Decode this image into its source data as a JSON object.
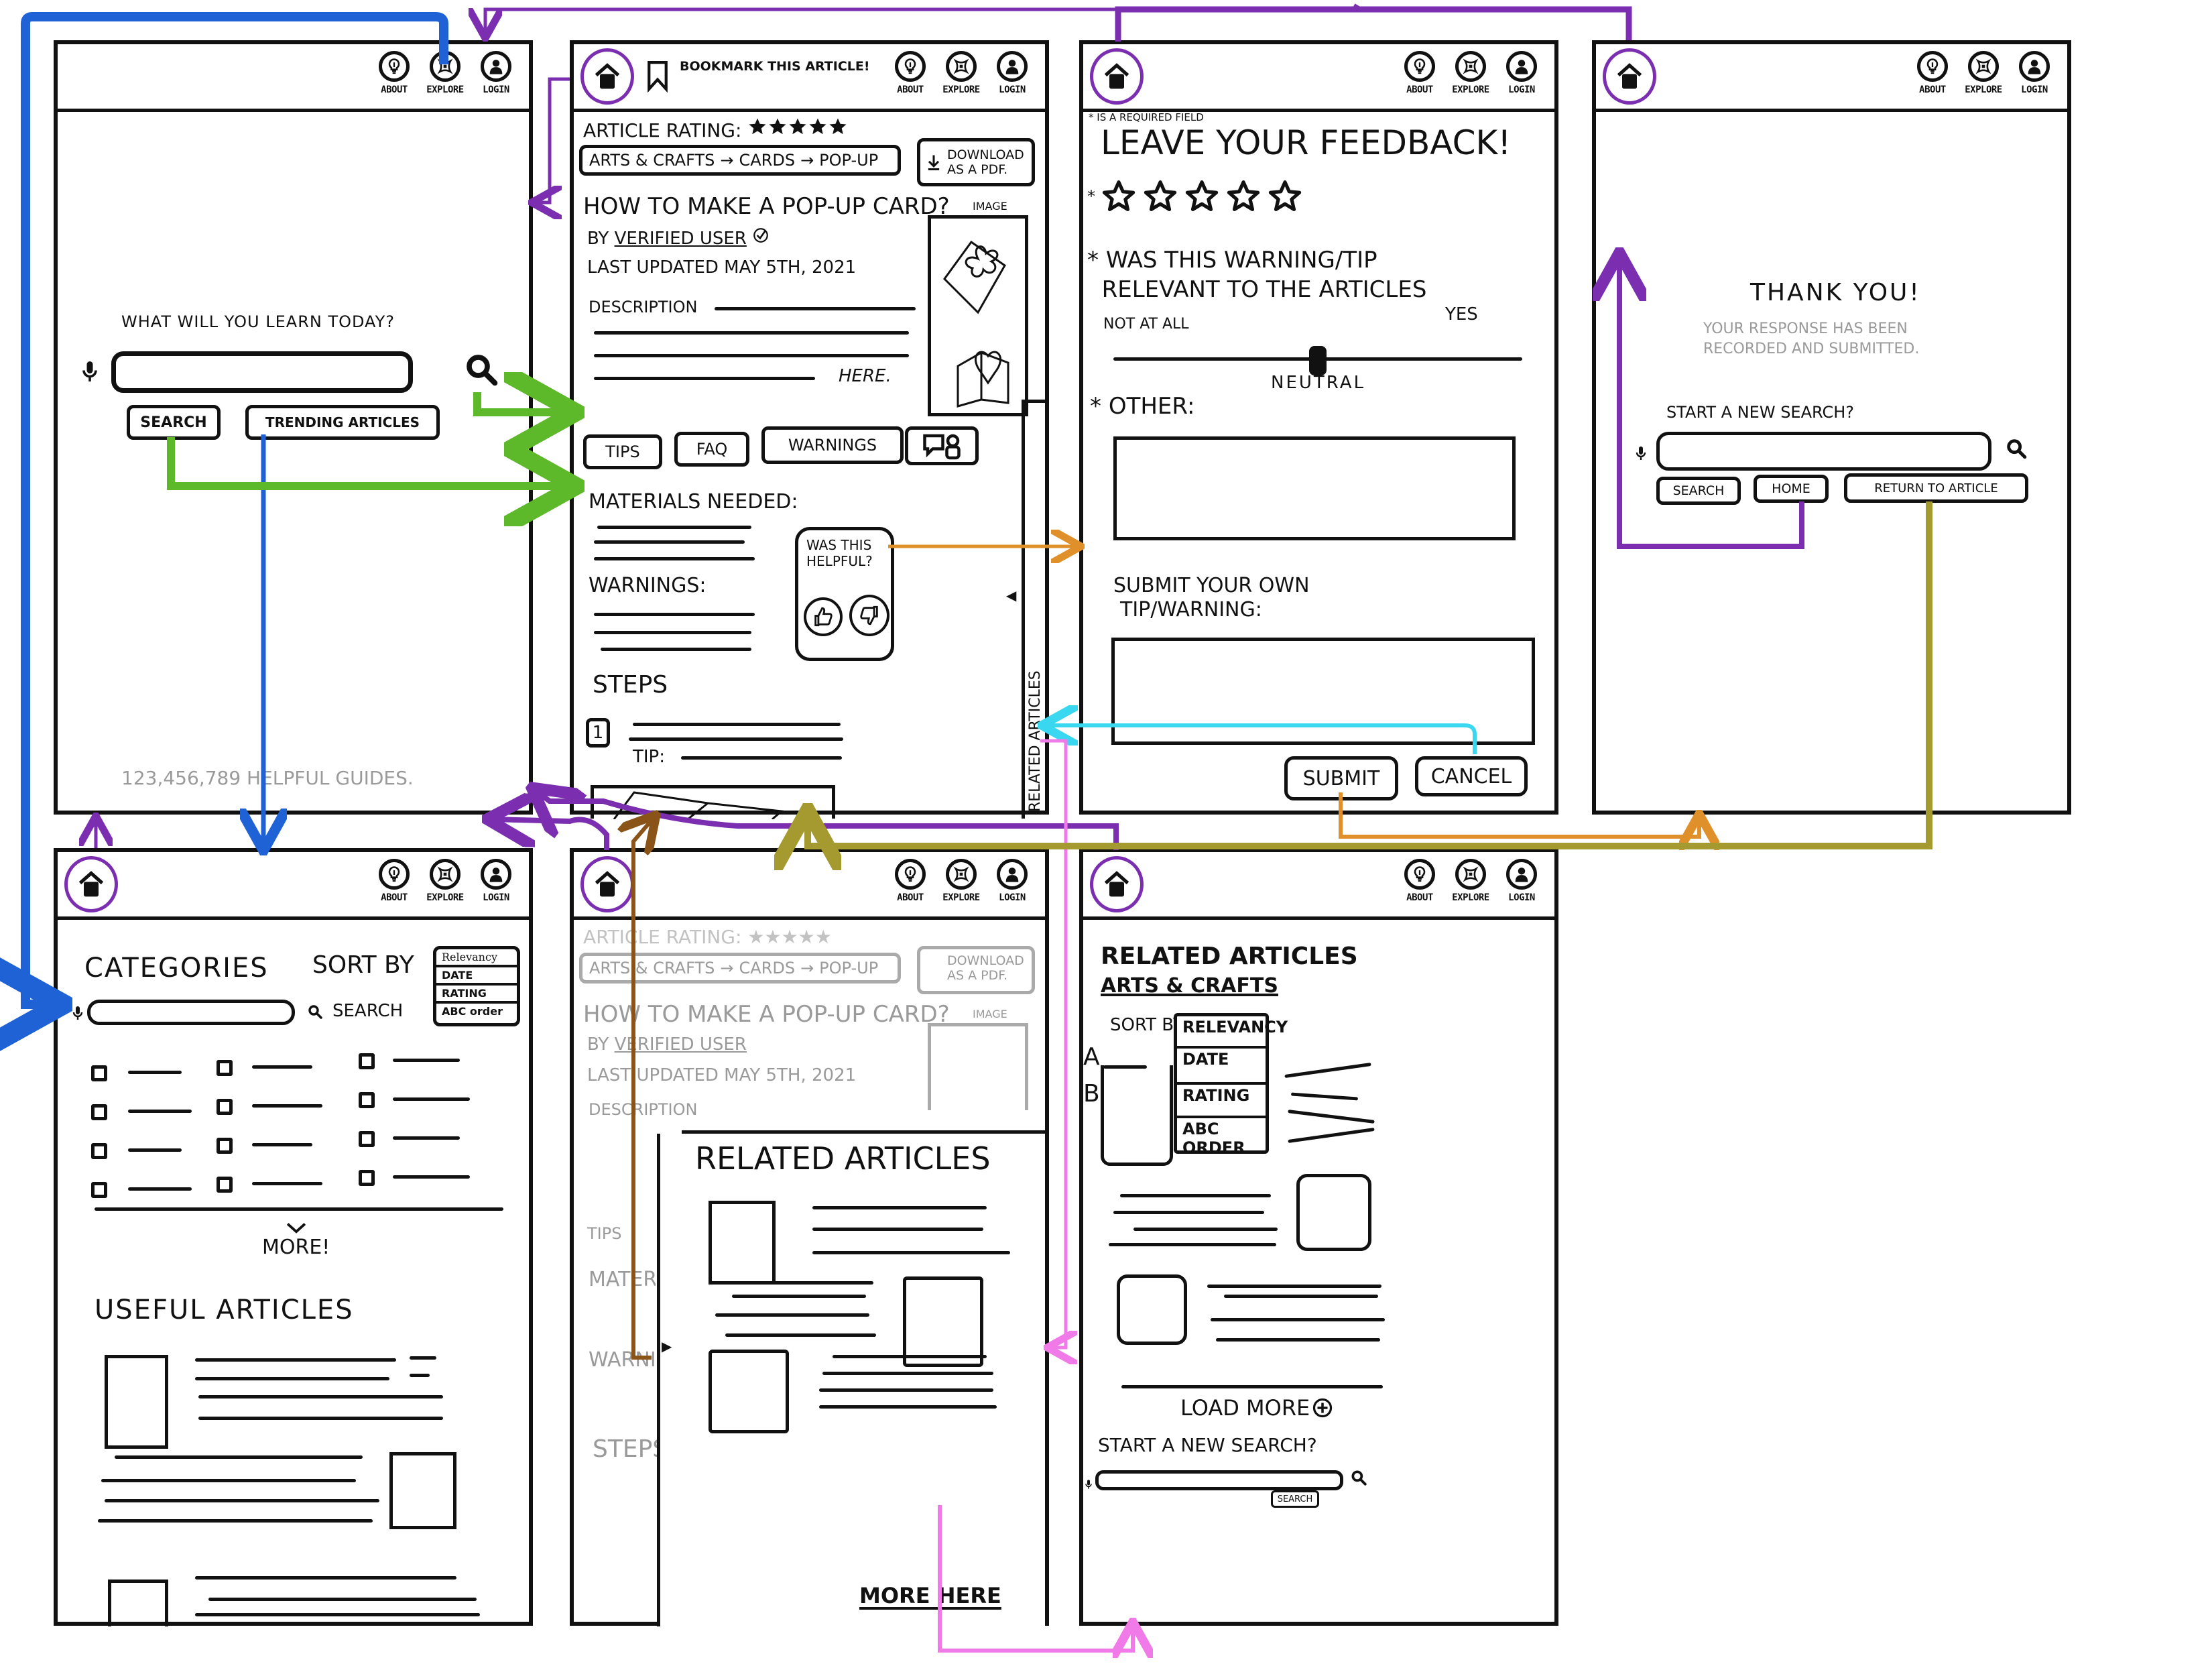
{
  "nav": {
    "about": "ABOUT",
    "explore": "EXPLORE",
    "login": "LOGIN",
    "icons": {
      "about": "lightbulb-icon",
      "explore": "compass-icon",
      "login": "user-icon",
      "home": "home-icon"
    }
  },
  "colors": {
    "ink": "#111111",
    "faded": "#9a9a9a",
    "flow_blue": "#1e62d6",
    "flow_purple": "#7b2fb0",
    "flow_green": "#5db82a",
    "flow_orange": "#e0902a",
    "flow_cyan": "#3ad8f0",
    "flow_pink": "#f07ae8",
    "flow_olive": "#a59a30",
    "flow_brown": "#8a5418"
  },
  "home_screen": {
    "prompt": "WHAT WILL YOU LEARN TODAY?",
    "search_placeholder": "",
    "search_button": "SEARCH",
    "trending_button": "TRENDING ARTICLES",
    "footer_count": "123,456,789",
    "footer_text": "HELPFUL GUIDES."
  },
  "article_screen": {
    "bookmark": "BOOKMARK THIS ARTICLE!",
    "rating_label": "ARTICLE RATING:",
    "rating_stars": 5,
    "breadcrumb": [
      "ARTS & CRAFTS",
      "CARDS",
      "POP-UP"
    ],
    "breadcrumb_sep": "→",
    "download_line1": "DOWNLOAD",
    "download_line2": "AS A PDF.",
    "title": "HOW TO MAKE A POP-UP CARD?",
    "by_label": "BY",
    "author": "VERIFIED USER",
    "updated": "LAST UPDATED MAY 5TH, 2021",
    "description_label": "DESCRIPTION",
    "description_end": "HERE.",
    "image_label": "IMAGE",
    "tabs": [
      "TIPS",
      "FAQ",
      "WARNINGS"
    ],
    "materials_label": "MATERIALS NEEDED:",
    "warnings_label": "WARNINGS:",
    "helpful_line1": "WAS THIS",
    "helpful_line2": "HELPFUL?",
    "steps_label": "STEPS",
    "step_number": "1",
    "tip_label": "TIP:",
    "related_tab": "RELATED ARTICLES"
  },
  "feedback_screen": {
    "required_note": "IS A REQUIRED FIELD",
    "title": "LEAVE YOUR FEEDBACK!",
    "star_count": 5,
    "question_line1": "WAS THIS WARNING/TIP",
    "question_line2": "RELEVANT TO THE ARTICLES",
    "slider_min": "NOT AT ALL",
    "slider_max": "YES",
    "slider_mid": "NEUTRAL",
    "slider_value": 0.5,
    "other_label": "OTHER:",
    "submit_own_line1": "SUBMIT YOUR OWN",
    "submit_own_line2": "TIP/WARNING:",
    "submit_button": "SUBMIT",
    "cancel_button": "CANCEL"
  },
  "thanks_screen": {
    "title": "THANK YOU!",
    "message_line1": "YOUR RESPONSE HAS BEEN",
    "message_line2": "RECORDED AND SUBMITTED.",
    "new_search": "START A NEW SEARCH?",
    "search_button": "SEARCH",
    "home_button": "HOME",
    "return_button": "RETURN TO ARTICLE"
  },
  "categories_screen": {
    "title": "CATEGORIES",
    "sort_label": "SORT BY",
    "sort_options": [
      "Relevancy",
      "DATE",
      "RATING",
      "ABC order"
    ],
    "search_label": "SEARCH",
    "more": "MORE!",
    "useful_title": "USEFUL ARTICLES"
  },
  "related_overlay": {
    "title": "RELATED ARTICLES",
    "more": "MORE HERE"
  },
  "related_list_screen": {
    "title": "RELATED ARTICLES",
    "category": "ARTS & CRAFTS",
    "sort_label": "SORT BY",
    "sort_options": [
      "RELEVANCY",
      "DATE",
      "RATING",
      "ABC ORDER"
    ],
    "marker_a": "A",
    "marker_b": "B",
    "load_more": "LOAD MORE",
    "new_search": "START A NEW SEARCH?",
    "search_button": "SEARCH"
  }
}
